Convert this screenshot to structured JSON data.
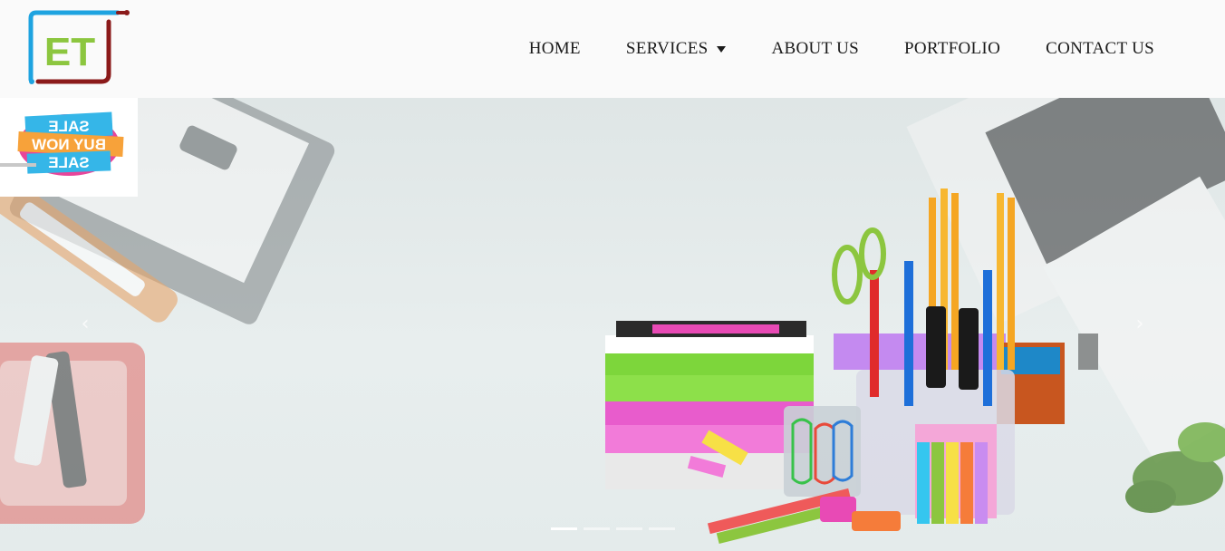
{
  "logo": {
    "letters": "ET",
    "colors": {
      "frame_left": "#1ea3e0",
      "frame_right": "#8b1a1a",
      "letters": "#8cc63f"
    }
  },
  "nav": {
    "items": [
      {
        "label": "HOME"
      },
      {
        "label": "SERVICES",
        "has_dropdown": true
      },
      {
        "label": "ABOUT US"
      },
      {
        "label": "PORTFOLIO"
      },
      {
        "label": "CONTACT US"
      }
    ]
  },
  "promo": {
    "line1": "SALE",
    "line2": "BUY NOW",
    "line3": "SALE",
    "mirrored": true
  },
  "carousel": {
    "prev_icon": "chevron-left-icon",
    "next_icon": "chevron-right-icon",
    "prev_glyph": "‹",
    "next_glyph": "›",
    "slide_count": 4,
    "active_index": 0
  }
}
